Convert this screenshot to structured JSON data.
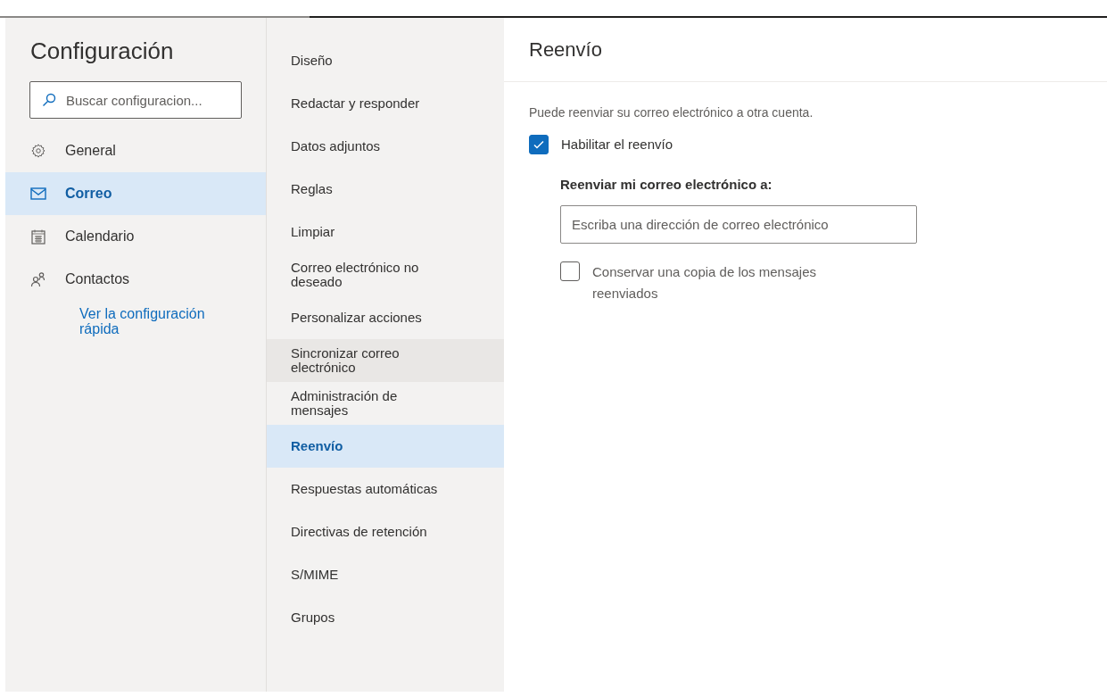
{
  "sidebar": {
    "title": "Configuración",
    "search": {
      "placeholder": "Buscar configuracion..."
    },
    "items": [
      {
        "label": "General",
        "selected": false
      },
      {
        "label": "Correo",
        "selected": true
      },
      {
        "label": "Calendario",
        "selected": false
      },
      {
        "label": "Contactos",
        "selected": false
      }
    ],
    "link": "Ver la configuración rápida"
  },
  "submenu": {
    "items": [
      {
        "label": "Diseño",
        "selected": false,
        "hovered": false
      },
      {
        "label": "Redactar y responder",
        "selected": false,
        "hovered": false
      },
      {
        "label": "Datos adjuntos",
        "selected": false,
        "hovered": false
      },
      {
        "label": "Reglas",
        "selected": false,
        "hovered": false
      },
      {
        "label": "Limpiar",
        "selected": false,
        "hovered": false
      },
      {
        "label": "Correo electrónico no deseado",
        "selected": false,
        "hovered": false
      },
      {
        "label": "Personalizar acciones",
        "selected": false,
        "hovered": false
      },
      {
        "label": "Sincronizar correo electrónico",
        "selected": false,
        "hovered": true
      },
      {
        "label": "Administración de mensajes",
        "selected": false,
        "hovered": false
      },
      {
        "label": "Reenvío",
        "selected": true,
        "hovered": false
      },
      {
        "label": "Respuestas automáticas",
        "selected": false,
        "hovered": false
      },
      {
        "label": "Directivas de retención",
        "selected": false,
        "hovered": false
      },
      {
        "label": "S/MIME",
        "selected": false,
        "hovered": false
      },
      {
        "label": "Grupos",
        "selected": false,
        "hovered": false
      }
    ]
  },
  "content": {
    "title": "Reenvío",
    "description": "Puede reenviar su correo electrónico a otra cuenta.",
    "enable": {
      "label": "Habilitar el reenvío",
      "checked": true
    },
    "field_label": "Reenviar mi correo electrónico a:",
    "field": {
      "placeholder": "Escriba una dirección de correo electrónico"
    },
    "keep_copy": {
      "label": "Conservar una copia de los mensajes reenviados",
      "checked": false
    }
  }
}
